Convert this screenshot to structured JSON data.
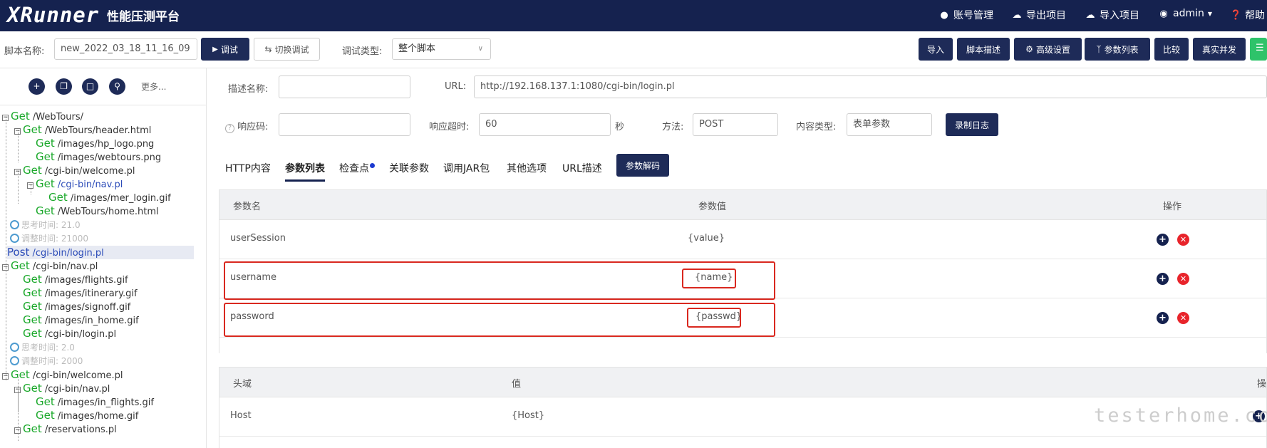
{
  "header": {
    "logo": "XRunner",
    "platform_title": "性能压测平台",
    "nav": [
      {
        "icon": "user-icon",
        "label": "账号管理"
      },
      {
        "icon": "cloud-download-icon",
        "label": "导出项目"
      },
      {
        "icon": "cloud-upload-icon",
        "label": "导入项目"
      },
      {
        "icon": "user-circle-icon",
        "label": "admin"
      },
      {
        "icon": "help-icon",
        "label": "帮助"
      }
    ]
  },
  "toolbar": {
    "script_name_label": "脚本名称:",
    "script_name_value": "new_2022_03_18_11_16_09",
    "debug_button": "调试",
    "switch_debug_button": "切换调试",
    "debug_type_label": "调试类型:",
    "debug_type_value": "整个脚本",
    "right_buttons": [
      "导入",
      "脚本描述",
      "高级设置",
      "参数列表",
      "比较",
      "真实并发"
    ]
  },
  "sidebar": {
    "more": "更多...",
    "tree": [
      {
        "method": "Get",
        "path": "/WebTours/"
      },
      {
        "method": "Get",
        "path": "/WebTours/header.html"
      },
      {
        "method": "Get",
        "path": "/images/hp_logo.png"
      },
      {
        "method": "Get",
        "path": "/images/webtours.png"
      },
      {
        "method": "Get",
        "path": "/cgi-bin/welcome.pl"
      },
      {
        "method": "Get",
        "path": "/cgi-bin/nav.pl"
      },
      {
        "method": "Get",
        "path": "/images/mer_login.gif"
      },
      {
        "method": "Get",
        "path": "/WebTours/home.html"
      },
      {
        "text": "思考时间: 21.0"
      },
      {
        "text": "调整时间: 21000"
      },
      {
        "method": "Post",
        "path": "/cgi-bin/login.pl"
      },
      {
        "method": "Get",
        "path": "/cgi-bin/nav.pl"
      },
      {
        "method": "Get",
        "path": "/images/flights.gif"
      },
      {
        "method": "Get",
        "path": "/images/itinerary.gif"
      },
      {
        "method": "Get",
        "path": "/images/signoff.gif"
      },
      {
        "method": "Get",
        "path": "/images/in_home.gif"
      },
      {
        "method": "Get",
        "path": "/cgi-bin/login.pl"
      },
      {
        "text": "思考时间: 2.0"
      },
      {
        "text": "调整时间: 2000"
      },
      {
        "method": "Get",
        "path": "/cgi-bin/welcome.pl"
      },
      {
        "method": "Get",
        "path": "/cgi-bin/nav.pl"
      },
      {
        "method": "Get",
        "path": "/images/in_flights.gif"
      },
      {
        "method": "Get",
        "path": "/images/home.gif"
      },
      {
        "method": "Get",
        "path": "/reservations.pl"
      }
    ]
  },
  "form": {
    "desc_label": "描述名称:",
    "desc_value": "",
    "url_label": "URL:",
    "url_value": "http://192.168.137.1:1080/cgi-bin/login.pl",
    "resp_code_label": "响应码:",
    "resp_code_value": "",
    "timeout_label": "响应超时:",
    "timeout_value": "60",
    "timeout_unit": "秒",
    "method_label": "方法:",
    "method_value": "POST",
    "content_type_label": "内容类型:",
    "content_type_value": "表单参数",
    "record_log_button": "录制日志"
  },
  "tabs": [
    "HTTP内容",
    "参数列表",
    "检查点",
    "关联参数",
    "调用JAR包",
    "其他选项",
    "URL描述"
  ],
  "decode_button": "参数解码",
  "params_table": {
    "headers": [
      "参数名",
      "参数值",
      "操作"
    ],
    "rows": [
      {
        "name": "userSession",
        "value": "{value}"
      },
      {
        "name": "username",
        "value": "{name}"
      },
      {
        "name": "password",
        "value": "{passwd}"
      }
    ]
  },
  "headers_table": {
    "headers": [
      "头域",
      "值",
      "操"
    ],
    "rows": [
      {
        "name": "Host",
        "value": "{Host}"
      }
    ]
  },
  "watermark": "testerhome.com"
}
